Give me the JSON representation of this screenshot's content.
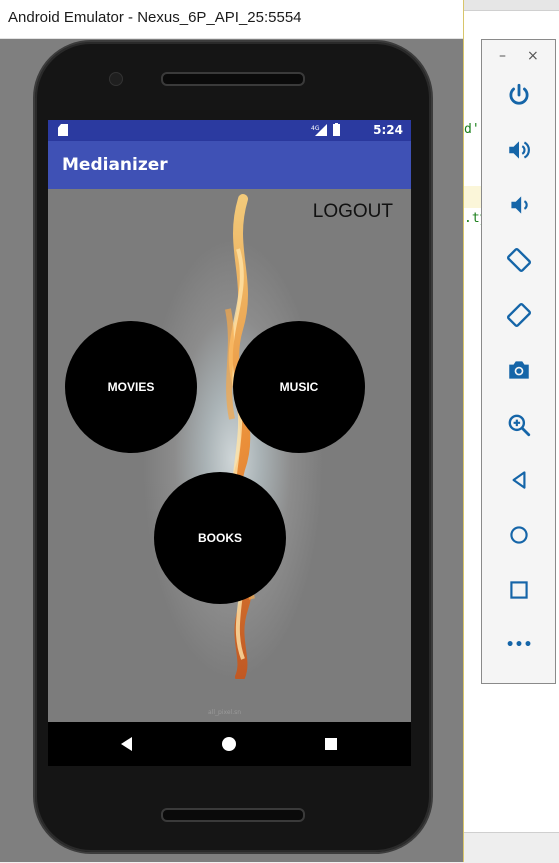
{
  "window": {
    "title": "Android Emulator - Nexus_6P_API_25:5554"
  },
  "ide": {
    "fragments": [
      "d'",
      ".ty"
    ]
  },
  "status_bar": {
    "time": "5:24",
    "network": "4G"
  },
  "app": {
    "title": "Medianizer",
    "logout": "LOGOUT"
  },
  "menu": {
    "movies": "MOVIES",
    "music": "MUSIC",
    "books": "BOOKS"
  },
  "watermark": "all_pixel.sn",
  "toolbar": {
    "minimize": "–",
    "close": "×",
    "more": "•••"
  },
  "colors": {
    "status_bar": "#2b3aa0",
    "app_bar": "#3f51b5",
    "toolbar_icon": "#1565a8",
    "circle": "#000000"
  }
}
